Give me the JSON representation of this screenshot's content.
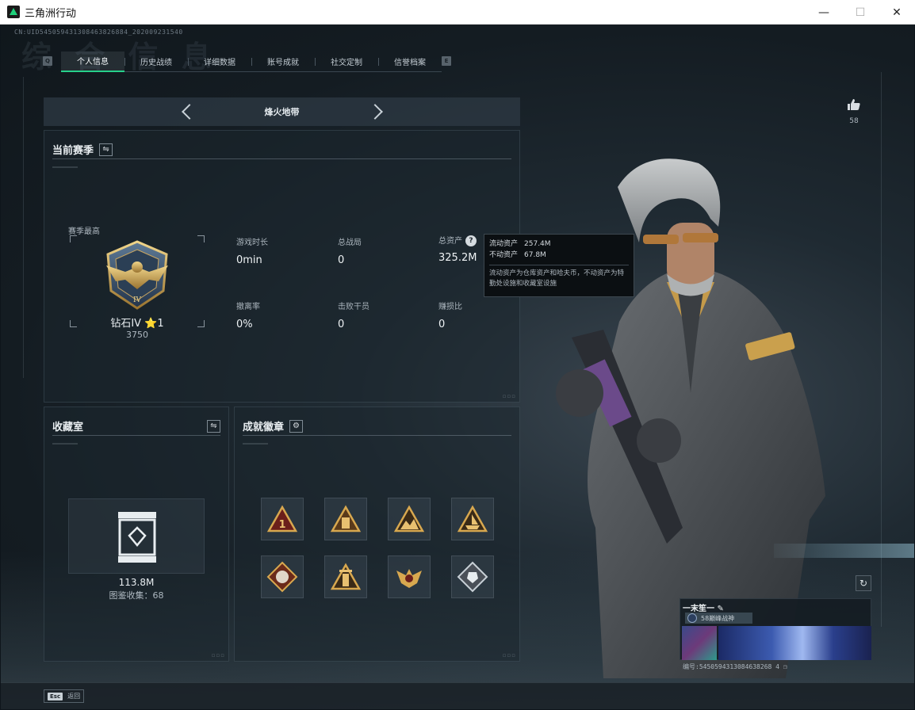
{
  "window": {
    "title": "三角洲行动",
    "minimize": "—",
    "maximize": "☐",
    "close": "✕"
  },
  "header": {
    "uid": "CN:UID545059431308463826884_202009231540",
    "tabs": [
      {
        "label": "个人信息",
        "active": true
      },
      {
        "label": "历史战绩",
        "active": false
      },
      {
        "label": "详细数据",
        "active": false
      },
      {
        "label": "账号成就",
        "active": false
      },
      {
        "label": "社交定制",
        "active": false
      },
      {
        "label": "信誉档案",
        "active": false
      }
    ],
    "key_left": "Q",
    "key_right": "E"
  },
  "mode": {
    "label": "烽火地带"
  },
  "season": {
    "title": "当前赛季",
    "highest_label": "赛季最高",
    "rank_name": "钻石IV ⭐1",
    "rank_score": "3750",
    "stats": [
      {
        "label": "游戏时长",
        "value": "0min"
      },
      {
        "label": "总战局",
        "value": "0"
      },
      {
        "label": "总资产",
        "value": "325.2M"
      },
      {
        "label": "撤离率",
        "value": "0%"
      },
      {
        "label": "击败干员",
        "value": "0"
      },
      {
        "label": "赚损比",
        "value": "0"
      }
    ]
  },
  "tooltip": {
    "liquid_label": "流动资产",
    "liquid_value": "257.4M",
    "fixed_label": "不动资产",
    "fixed_value": "67.8M",
    "description": "流动资产为仓库资产和哈夫币，不动资产为特勤处设施和收藏室设施"
  },
  "collection": {
    "title": "收藏室",
    "value": "113.8M",
    "count_label": "图鉴收集：68"
  },
  "badges": {
    "title": "成就徽章",
    "items": [
      {
        "icon": "rank-1-badge-icon"
      },
      {
        "icon": "pillar-badge-icon"
      },
      {
        "icon": "landscape-badge-icon"
      },
      {
        "icon": "ship-badge-icon"
      },
      {
        "icon": "wolf-badge-icon"
      },
      {
        "icon": "tower-badge-icon"
      },
      {
        "icon": "eagle-badge-icon"
      },
      {
        "icon": "crystal-badge-icon"
      }
    ]
  },
  "profile": {
    "likes": "58",
    "nickname": "一末笙一",
    "title_badge": "58巅峰战神",
    "id_line": "编号:5450594313084638268 4"
  },
  "footer": {
    "esc_key": "Esc",
    "esc_label": "返回"
  }
}
